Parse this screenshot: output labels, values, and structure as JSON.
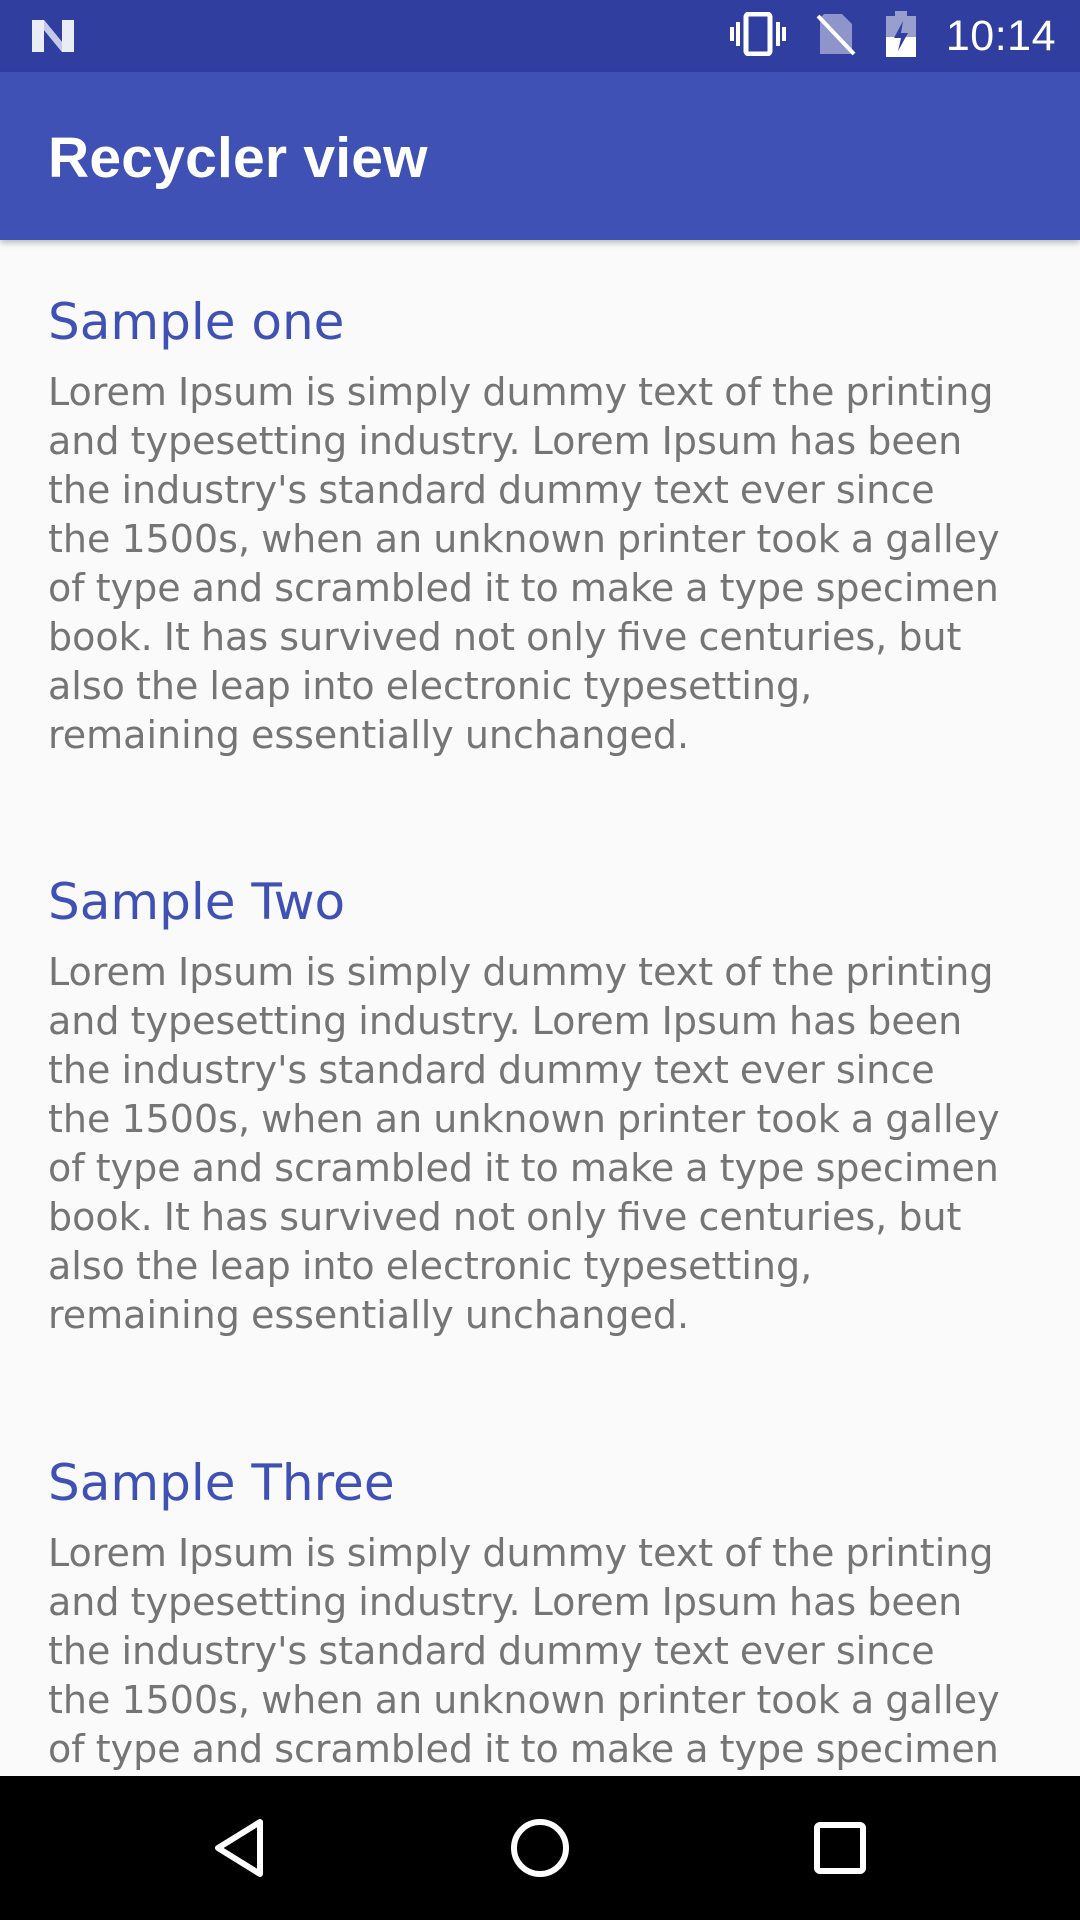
{
  "status_bar": {
    "time": "10:14",
    "icons": [
      "notification-n-icon",
      "vibrate-icon",
      "no-sim-icon",
      "battery-charging-icon"
    ]
  },
  "app_bar": {
    "title": "Recycler view"
  },
  "list": {
    "items": [
      {
        "title": "Sample one",
        "body": "Lorem Ipsum is simply dummy text of the printing and typesetting industry. Lorem Ipsum has been the industry's standard dummy text ever since the 1500s, when an unknown printer took a galley of type and scrambled it to make a type specimen book. It has survived not only five centuries, but also the leap into electronic typesetting, remaining essentially unchanged."
      },
      {
        "title": "Sample Two",
        "body": "Lorem Ipsum is simply dummy text of the printing and typesetting industry. Lorem Ipsum has been the industry's standard dummy text ever since the 1500s, when an unknown printer took a galley of type and scrambled it to make a type specimen book. It has survived not only five centuries, but also the leap into electronic typesetting, remaining essentially unchanged."
      },
      {
        "title": "Sample Three",
        "body": "Lorem Ipsum is simply dummy text of the printing and typesetting industry. Lorem Ipsum has been the industry's standard dummy text ever since the 1500s, when an unknown printer took a galley of type and scrambled it to make a type specimen"
      }
    ]
  },
  "nav_bar": {
    "buttons": [
      "back-icon",
      "home-icon",
      "recents-icon"
    ]
  },
  "colors": {
    "primary": "#3f51b5",
    "primary_dark": "#303f9f",
    "title_text": "#3f51b5",
    "body_text": "#757575",
    "background": "#fafafa"
  }
}
